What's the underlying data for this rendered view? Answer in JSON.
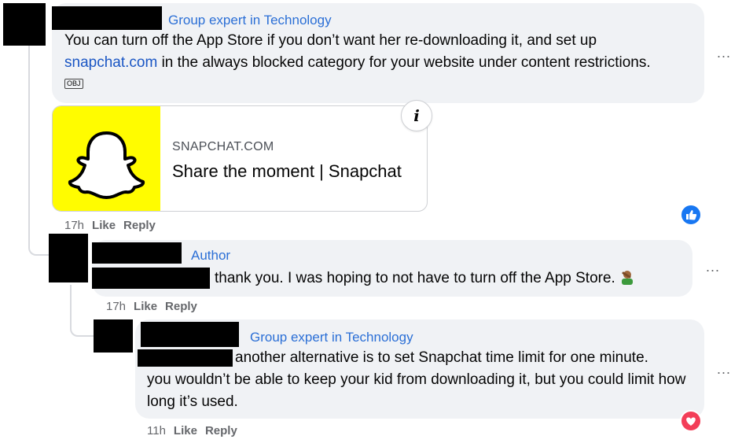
{
  "comments": [
    {
      "badge": "Group expert in Technology",
      "text_part1": "You can turn off the App Store if you don’t want her re-downloading it, and set up",
      "link_text": "snapchat.com",
      "text_part2": " in the always blocked category for your website under content restrictions. ",
      "text_suffix_icon": "obj-placeholder-icon",
      "link_preview": {
        "domain": "SNAPCHAT.COM",
        "title": "Share the moment | Snapchat",
        "info_icon": "i",
        "logo_icon": "snapchat-ghost-icon"
      },
      "time": "17h",
      "like_label": "Like",
      "reply_label": "Reply",
      "reaction": "like",
      "more_label": "..."
    },
    {
      "badge": "Author",
      "text": "thank you. I was hoping to not have to turn off the App Store.",
      "emoji": "person-facepalming-emoji",
      "time": "17h",
      "like_label": "Like",
      "reply_label": "Reply",
      "more_label": "..."
    },
    {
      "badge": "Group expert in Technology",
      "text_line1": "another alternative is to set Snapchat time limit for one minute.",
      "text_rest": "you wouldn’t be able to keep your kid from downloading it, but you could limit how long it’s used.",
      "time": "11h",
      "like_label": "Like",
      "reply_label": "Reply",
      "reaction": "love",
      "more_label": "..."
    }
  ],
  "colors": {
    "bubble": "#f0f2f5",
    "badge": "#2b6fd6",
    "link": "#1a56c4",
    "meta": "#65676b",
    "like_blue": "#1877f2",
    "love_red": "#f33e58",
    "snapchat_yellow": "#fffc00"
  }
}
